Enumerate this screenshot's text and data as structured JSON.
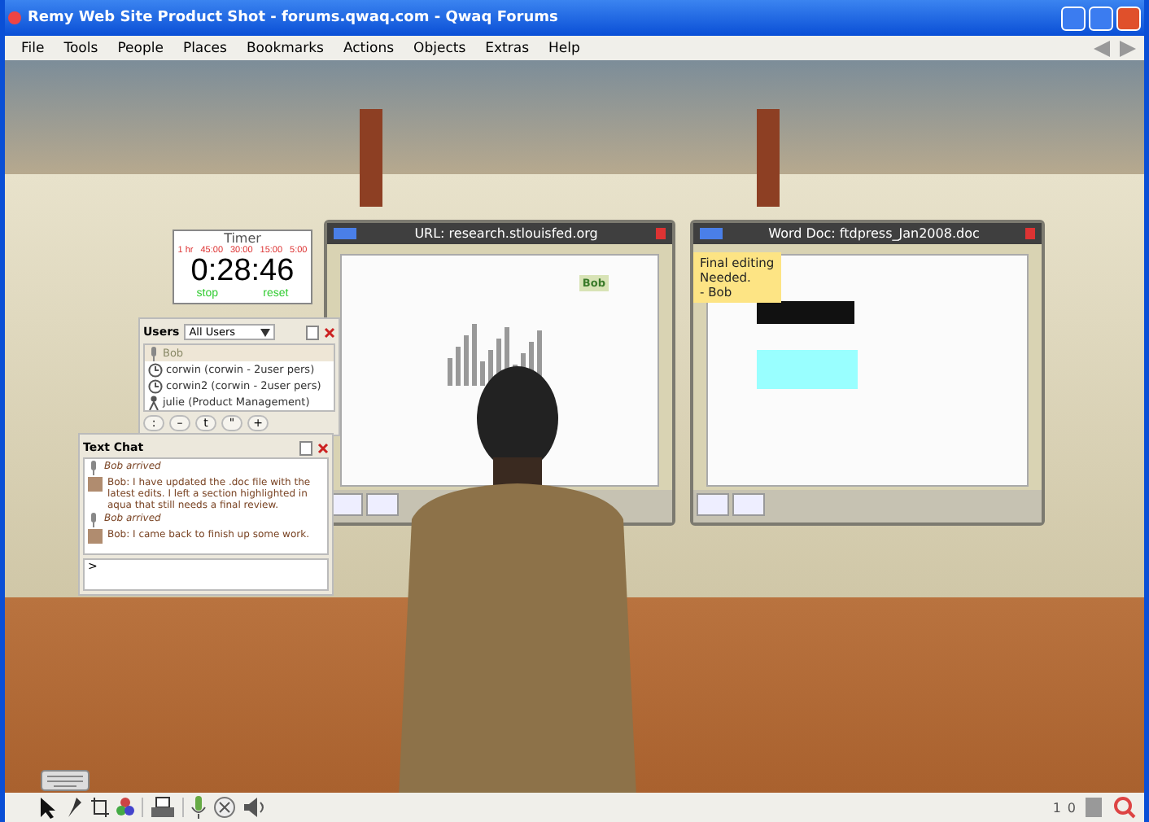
{
  "window": {
    "title": "Remy Web Site Product Shot - forums.qwaq.com - Qwaq Forums"
  },
  "menu": [
    "File",
    "Tools",
    "People",
    "Places",
    "Bookmarks",
    "Actions",
    "Objects",
    "Extras",
    "Help"
  ],
  "timer": {
    "title": "Timer",
    "presets": [
      "1 hr",
      "45:00",
      "30:00",
      "15:00",
      "5:00"
    ],
    "time": "0:28:46",
    "actions": [
      "stop",
      "reset"
    ]
  },
  "users": {
    "title": "Users",
    "filter": "All Users",
    "items": [
      {
        "kind": "speaking",
        "name": "Bob",
        "selected": true
      },
      {
        "kind": "clock",
        "name": "corwin  (corwin - 2user pers)",
        "selected": false
      },
      {
        "kind": "clock",
        "name": "corwin2  (corwin - 2user pers)",
        "selected": false
      },
      {
        "kind": "person",
        "name": "julie  (Product Management)",
        "selected": false
      }
    ],
    "buttons": [
      ":",
      "–",
      "t",
      "\"",
      "+"
    ]
  },
  "chat": {
    "title": "Text Chat",
    "messages": [
      {
        "kind": "event",
        "text": "Bob arrived"
      },
      {
        "kind": "message",
        "text": "Bob: I have updated the .doc file with the latest edits.  I left a section highlighted in aqua that still needs a final review."
      },
      {
        "kind": "event",
        "text": "Bob arrived"
      },
      {
        "kind": "message",
        "text": "Bob: I came back to finish up some work."
      }
    ],
    "prompt": ">"
  },
  "panels": [
    {
      "kind": "browser",
      "title": "URL: research.stlouisfed.org",
      "tag": "Bob"
    },
    {
      "kind": "document",
      "title": "Word Doc: ftdpress_Jan2008.doc",
      "note": [
        "Final editing",
        "Needed.",
        "- Bob"
      ]
    }
  ],
  "status": {
    "counts": [
      "1",
      "0"
    ]
  }
}
